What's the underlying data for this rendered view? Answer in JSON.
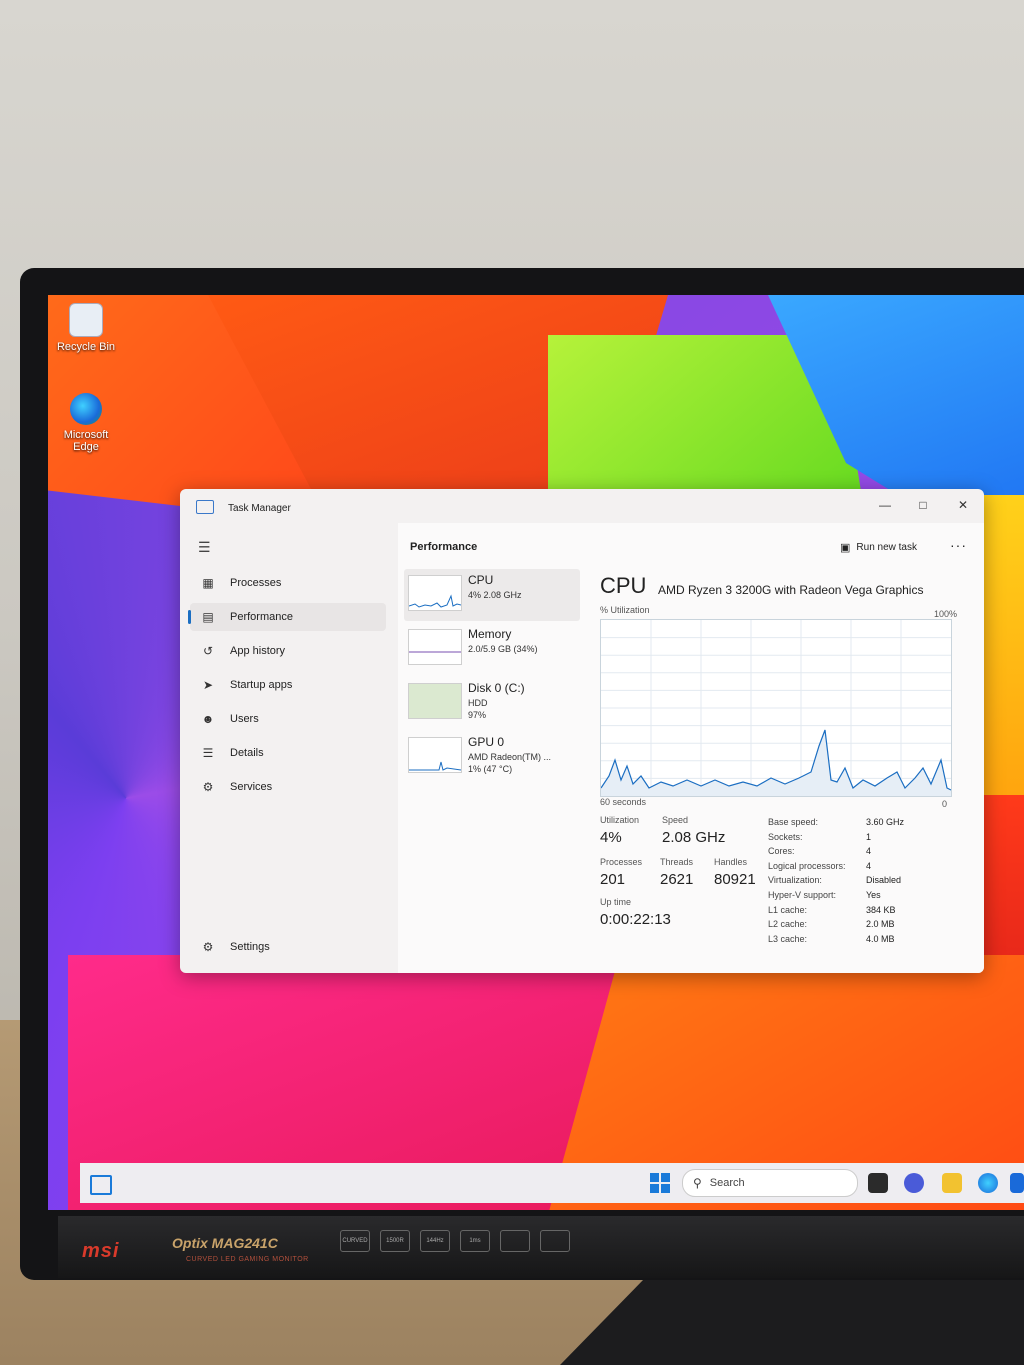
{
  "desktop": {
    "icons": [
      {
        "label": "Recycle Bin"
      },
      {
        "label": "Microsoft Edge"
      }
    ]
  },
  "taskmanager": {
    "title": "Task Manager",
    "nav": [
      {
        "label": "Processes",
        "icon": "processes-icon"
      },
      {
        "label": "Performance",
        "icon": "performance-icon",
        "active": true
      },
      {
        "label": "App history",
        "icon": "history-icon"
      },
      {
        "label": "Startup apps",
        "icon": "startup-icon"
      },
      {
        "label": "Users",
        "icon": "users-icon"
      },
      {
        "label": "Details",
        "icon": "details-icon"
      },
      {
        "label": "Services",
        "icon": "services-icon"
      }
    ],
    "settings_label": "Settings",
    "header": {
      "title": "Performance",
      "run_task": "Run new task",
      "more": "···"
    },
    "devices": [
      {
        "name": "CPU",
        "sub1": "4% 2.08 GHz",
        "sub2": "",
        "sub3": ""
      },
      {
        "name": "Memory",
        "sub1": "2.0/5.9 GB (34%)",
        "sub2": "",
        "sub3": ""
      },
      {
        "name": "Disk 0 (C:)",
        "sub1": "HDD",
        "sub2": "97%",
        "sub3": ""
      },
      {
        "name": "GPU 0",
        "sub1": "AMD Radeon(TM) ...",
        "sub2": "1% (47 °C)",
        "sub3": ""
      }
    ],
    "detail": {
      "heading": "CPU",
      "model": "AMD Ryzen 3 3200G with Radeon Vega Graphics",
      "util_label": "% Utilization",
      "max_label": "100%",
      "time_label": "60 seconds",
      "min_label": "0",
      "stats": {
        "utilization_label": "Utilization",
        "utilization": "4%",
        "speed_label": "Speed",
        "speed": "2.08 GHz",
        "processes_label": "Processes",
        "processes": "201",
        "threads_label": "Threads",
        "threads": "2621",
        "handles_label": "Handles",
        "handles": "80921",
        "uptime_label": "Up time",
        "uptime": "0:00:22:13"
      },
      "specs": [
        {
          "k": "Base speed:",
          "v": "3.60 GHz"
        },
        {
          "k": "Sockets:",
          "v": "1"
        },
        {
          "k": "Cores:",
          "v": "4"
        },
        {
          "k": "Logical processors:",
          "v": "4"
        },
        {
          "k": "Virtualization:",
          "v": "Disabled"
        },
        {
          "k": "Hyper-V support:",
          "v": "Yes"
        },
        {
          "k": "L1 cache:",
          "v": "384 KB"
        },
        {
          "k": "L2 cache:",
          "v": "2.0 MB"
        },
        {
          "k": "L3 cache:",
          "v": "4.0 MB"
        }
      ]
    }
  },
  "taskbar": {
    "search_placeholder": "Search"
  },
  "monitor": {
    "brand": "msi",
    "model": "Optix MAG241C",
    "tagline": "CURVED LED GAMING MONITOR",
    "badges": [
      "CURVED",
      "1500R",
      "144Hz",
      "1ms",
      "",
      ""
    ]
  }
}
